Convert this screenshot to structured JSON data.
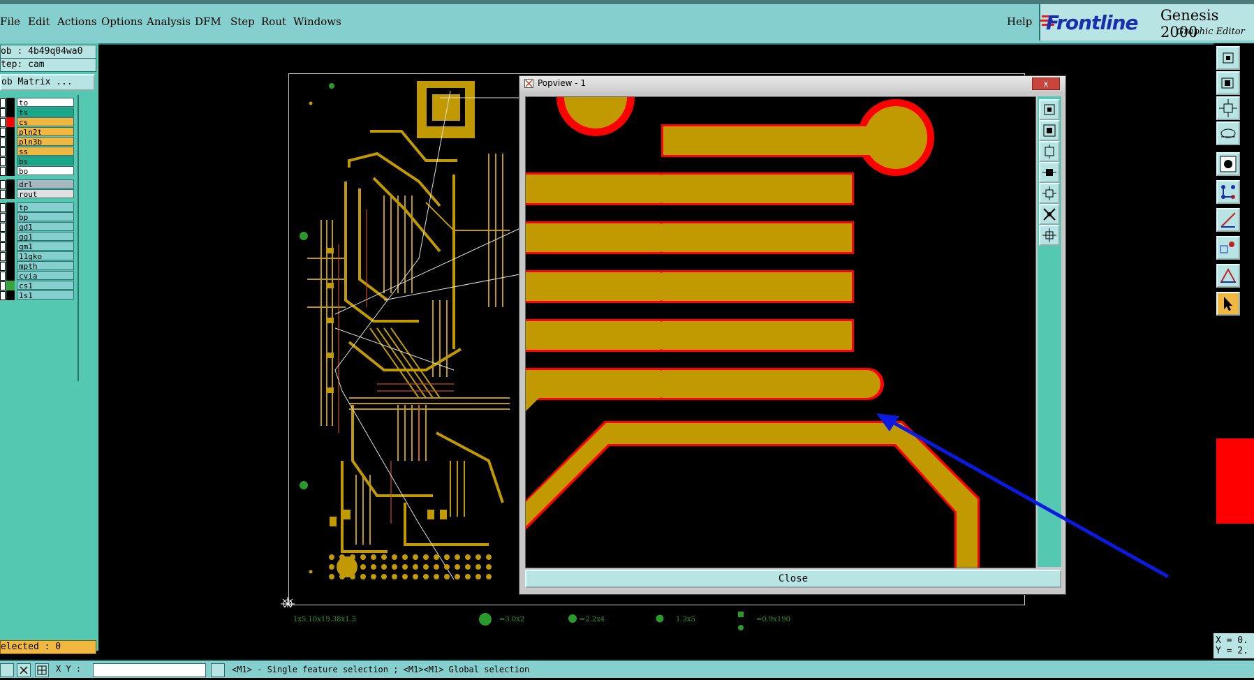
{
  "menu": {
    "items": [
      "File",
      "Edit",
      "Actions",
      "Options",
      "Analysis",
      "DFM",
      "Step",
      "Rout",
      "Windows"
    ],
    "help": "Help"
  },
  "logo": {
    "brand": "Frontline",
    "product": "Genesis 2000",
    "subtitle": "Graphic Editor"
  },
  "left_panel": {
    "job_line": "ob : 4b49q04wa0",
    "step_line": "tep: cam",
    "job_matrix": "ob Matrix ...",
    "layers": [
      {
        "name": "to",
        "bg": "#ffffff",
        "swatch": "#000000"
      },
      {
        "name": "ts",
        "bg": "#1aa88a",
        "swatch": "#000000"
      },
      {
        "name": "cs",
        "bg": "#f0b840",
        "swatch": "#ff0000"
      },
      {
        "name": "pln2t",
        "bg": "#f0b840",
        "swatch": "#000000"
      },
      {
        "name": "pln3b",
        "bg": "#f0b840",
        "swatch": "#000000"
      },
      {
        "name": "ss",
        "bg": "#f0b840",
        "swatch": "#000000"
      },
      {
        "name": "bs",
        "bg": "#1aa88a",
        "swatch": "#000000"
      },
      {
        "name": "bo",
        "bg": "#ffffff",
        "swatch": "#000000"
      },
      {
        "name": "drl",
        "bg": "#a8b8c0",
        "swatch": "#000000"
      },
      {
        "name": "rout",
        "bg": "#e0e0e0",
        "swatch": "#000000"
      },
      {
        "name": "tp",
        "bg": "#86cfcf",
        "swatch": "#000000"
      },
      {
        "name": "bp",
        "bg": "#86cfcf",
        "swatch": "#000000"
      },
      {
        "name": "gd1",
        "bg": "#86cfcf",
        "swatch": "#000000"
      },
      {
        "name": "gg1",
        "bg": "#86cfcf",
        "swatch": "#000000"
      },
      {
        "name": "gm1",
        "bg": "#86cfcf",
        "swatch": "#000000"
      },
      {
        "name": "11gko",
        "bg": "#86cfcf",
        "swatch": "#000000"
      },
      {
        "name": "mpth",
        "bg": "#86cfcf",
        "swatch": "#000000"
      },
      {
        "name": "cvia",
        "bg": "#86cfcf",
        "swatch": "#000000"
      },
      {
        "name": "cs1",
        "bg": "#86cfcf",
        "swatch": "#3aa33a"
      },
      {
        "name": "1s1",
        "bg": "#86cfcf",
        "swatch": "#000000"
      }
    ],
    "selected": "elected : 0"
  },
  "status_bar": {
    "xy_label": "X Y :",
    "message": "<M1> - Single feature selection ; <M1><M1> Global selection"
  },
  "right_panel": {
    "coord_x": "X = 0.",
    "coord_y": "Y = 2."
  },
  "board_legend": {
    "items": [
      "1x5.10x19.38x1.5",
      "=3.0x2",
      "=2.2x4",
      "1.3x5",
      "=0.9x190"
    ]
  },
  "popview": {
    "title": "Popview - 1",
    "close_button": "Close",
    "window_close_glyph": "x"
  },
  "colors": {
    "copper": "#c09a00",
    "highlight": "#ff0000",
    "panel_teal": "#86cfcf",
    "annotation_arrow": "#0a1ae0"
  }
}
